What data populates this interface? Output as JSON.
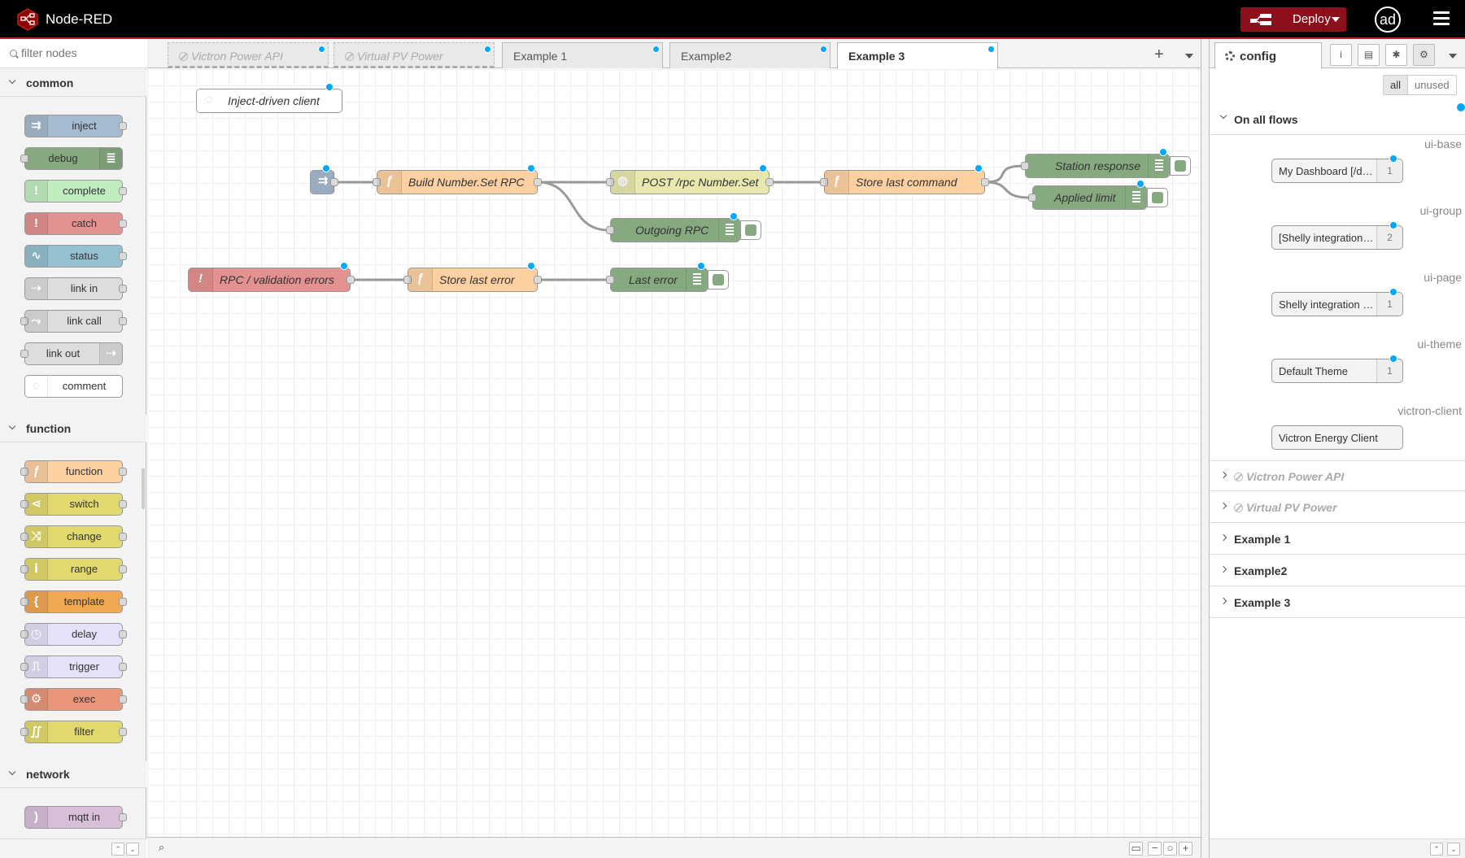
{
  "header": {
    "title": "Node-RED",
    "deploy_label": "Deploy",
    "user_initials": "ad",
    "colors": {
      "background": "#000000",
      "deploy": "#8c101c",
      "accent": "#c02020"
    }
  },
  "palette": {
    "search_placeholder": "filter nodes",
    "categories": {
      "common": "common",
      "function": "function",
      "network": "network"
    },
    "nodes": {
      "inject": "inject",
      "debug": "debug",
      "complete": "complete",
      "catch": "catch",
      "status": "status",
      "link_in": "link in",
      "link_call": "link call",
      "link_out": "link out",
      "comment": "comment",
      "function": "function",
      "switch": "switch",
      "change": "change",
      "range": "range",
      "template": "template",
      "delay": "delay",
      "trigger": "trigger",
      "exec": "exec",
      "filter": "filter",
      "mqtt_in": "mqtt in"
    }
  },
  "workspace": {
    "tabs": [
      {
        "label": "Victron Power API",
        "disabled": true
      },
      {
        "label": "Virtual PV Power",
        "disabled": true
      },
      {
        "label": "Example 1",
        "disabled": false
      },
      {
        "label": "Example2",
        "disabled": false
      },
      {
        "label": "Example 3",
        "disabled": false,
        "active": true
      }
    ],
    "flow_nodes": {
      "comment": "Inject-driven client",
      "build_rpc": "Build Number.Set RPC",
      "post_rpc": "POST /rpc Number.Set",
      "store_command": "Store last command",
      "station_response": "Station response",
      "applied_limit": "Applied limit",
      "outgoing_rpc": "Outgoing RPC",
      "catch_errors": "RPC / validation errors",
      "store_error": "Store last error",
      "last_error": "Last error"
    }
  },
  "sidebar": {
    "tab_label": "config",
    "filter": {
      "all": "all",
      "unused": "unused"
    },
    "on_all_flows": "On all flows",
    "config_nodes": [
      {
        "type": "ui-base",
        "label": "My Dashboard [/d…",
        "count": "1"
      },
      {
        "type": "ui-group",
        "label": "[Shelly integration …",
        "count": "2"
      },
      {
        "type": "ui-page",
        "label": "Shelly integration […",
        "count": "1"
      },
      {
        "type": "ui-theme",
        "label": "Default Theme",
        "count": "1"
      },
      {
        "type": "victron-client",
        "label": "Victron Energy Client",
        "count": ""
      }
    ],
    "flows": [
      {
        "label": "Victron Power API",
        "disabled": true
      },
      {
        "label": "Virtual PV Power",
        "disabled": true
      },
      {
        "label": "Example 1",
        "disabled": false
      },
      {
        "label": "Example2",
        "disabled": false
      },
      {
        "label": "Example 3",
        "disabled": false
      }
    ]
  }
}
